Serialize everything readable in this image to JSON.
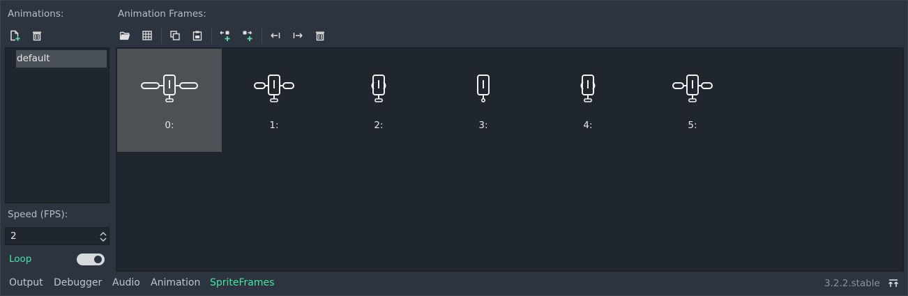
{
  "left": {
    "title": "Animations:",
    "animations": [
      "default"
    ],
    "speed_label": "Speed (FPS):",
    "speed_value": "2",
    "loop_label": "Loop"
  },
  "main": {
    "title": "Animation Frames:",
    "frames": [
      {
        "label": "0:",
        "variant": "wide"
      },
      {
        "label": "1:",
        "variant": "mid"
      },
      {
        "label": "2:",
        "variant": "narrow"
      },
      {
        "label": "3:",
        "variant": "single"
      },
      {
        "label": "4:",
        "variant": "narrow-r"
      },
      {
        "label": "5:",
        "variant": "mid"
      }
    ]
  },
  "bottom": {
    "tabs": [
      "Output",
      "Debugger",
      "Audio",
      "Animation",
      "SpriteFrames"
    ],
    "active_tab": "SpriteFrames",
    "version": "3.2.2.stable"
  },
  "colors": {
    "accent": "#4be3a4",
    "selected_frame": "#4d5156",
    "panel_bg": "#20262e",
    "window_bg": "#2c3440"
  },
  "icons": {
    "new_animation": "new-animation-icon",
    "delete_animation": "trash-icon",
    "load_frames": "folder-open-icon",
    "from_sheet": "grid-icon",
    "copy": "copy-icon",
    "paste": "paste-icon",
    "insert_before": "insert-before-icon",
    "insert_after": "insert-after-icon",
    "move_left": "move-left-icon",
    "move_right": "move-right-icon",
    "delete_frame": "trash-icon",
    "expand_panel": "expand-bottom-panel-icon"
  }
}
